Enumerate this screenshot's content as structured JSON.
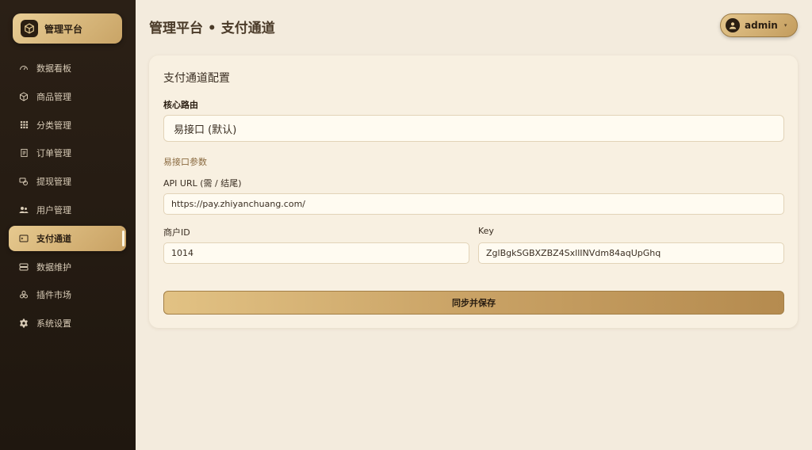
{
  "app": {
    "brand": "管理平台",
    "page_title": "管理平台 • 支付通道"
  },
  "user": {
    "name": "admin",
    "caret": "▾"
  },
  "sidebar": {
    "items": [
      {
        "label": "数据看板",
        "icon": "dashboard-icon"
      },
      {
        "label": "商品管理",
        "icon": "box-icon"
      },
      {
        "label": "分类管理",
        "icon": "grid-icon"
      },
      {
        "label": "订单管理",
        "icon": "receipt-icon"
      },
      {
        "label": "提现管理",
        "icon": "withdraw-icon"
      },
      {
        "label": "用户管理",
        "icon": "users-icon"
      },
      {
        "label": "支付通道",
        "icon": "payment-icon",
        "active": true
      },
      {
        "label": "数据维护",
        "icon": "database-icon"
      },
      {
        "label": "插件市场",
        "icon": "plugins-icon"
      },
      {
        "label": "系统设置",
        "icon": "gear-icon"
      }
    ]
  },
  "card": {
    "title": "支付通道配置",
    "route_label": "核心路由",
    "route_value": "易接口 (默认)",
    "section_label": "易接口参数",
    "api_url_label": "API URL (需 / 结尾)",
    "api_url_value": "https://pay.zhiyanchuang.com/",
    "merchant_label": "商户ID",
    "merchant_value": "1014",
    "key_label": "Key",
    "key_value": "ZglBgkSGBXZBZ4SxllINVdm84aqUpGhq",
    "save_label": "同步并保存"
  },
  "colors": {
    "accent": "#c9a466",
    "sidebar_bg": "#231a12",
    "page_bg": "#f3ebdd"
  }
}
